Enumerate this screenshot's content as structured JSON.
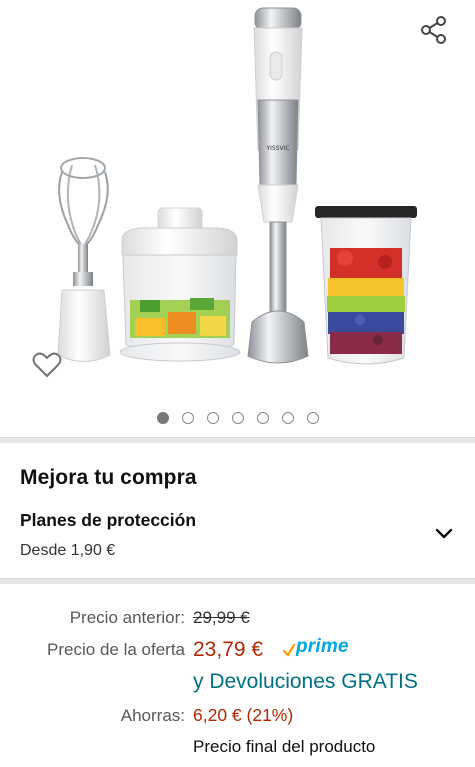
{
  "gallery": {
    "image_count": 7,
    "active_index": 0,
    "brand_label": "YISSVIC",
    "icons": {
      "share": "share-icon",
      "favorite": "heart-outline-icon"
    }
  },
  "upgrade": {
    "title": "Mejora tu compra",
    "protection_title": "Planes de protección",
    "protection_price": "Desde 1,90 €",
    "expand_icon": "chevron-down-icon"
  },
  "pricing": {
    "previous_label": "Precio anterior:",
    "previous_value": "29,99 €",
    "offer_label": "Precio de la oferta",
    "offer_value": "23,79 €",
    "prime_label": "prime",
    "returns_text": "y Devoluciones GRATIS",
    "savings_label": "Ahorras:",
    "savings_value": "6,20 € (21%)",
    "final_note": "Precio final del producto"
  },
  "colors": {
    "price_red": "#b12704",
    "link_teal": "#007185",
    "prime_blue": "#00a8e1",
    "prime_check": "#ff9900",
    "divider": "#e4e6e6"
  }
}
